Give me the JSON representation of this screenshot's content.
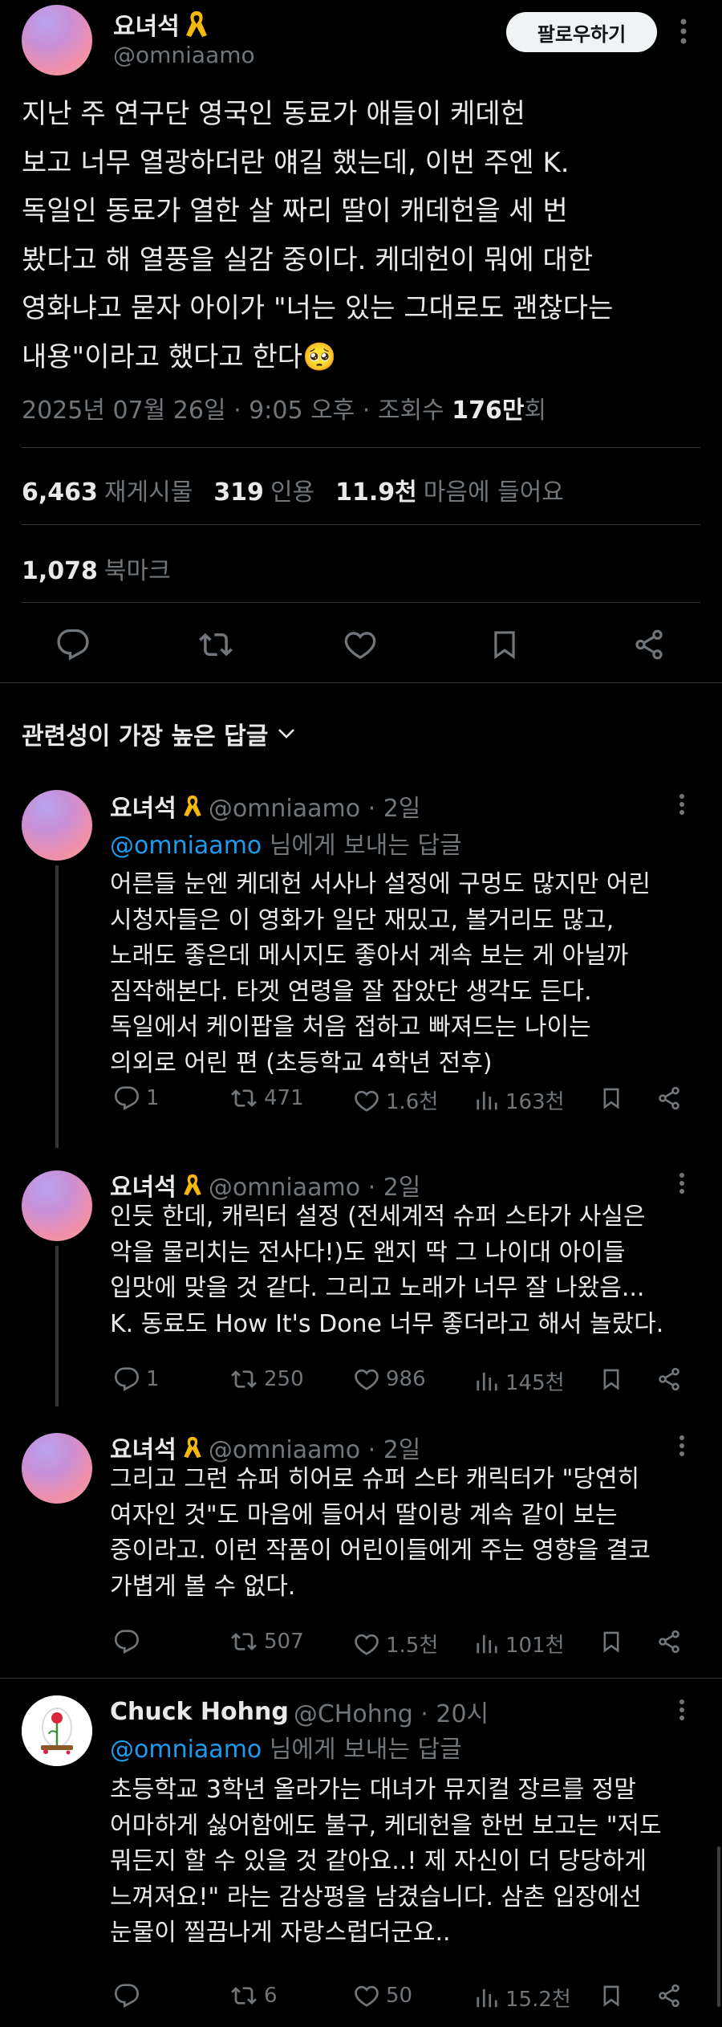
{
  "post": {
    "author_name": "요녀석",
    "author_handle": "@omniaamo",
    "follow_label": "팔로우하기",
    "text_lines": [
      "지난 주 연구단 영국인 동료가 애들이 케데헌",
      "보고 너무 열광하더란 얘길 했는데, 이번 주엔 K.",
      "독일인 동료가 열한 살 짜리 딸이 캐데헌을 세 번",
      "봤다고 해 열풍을 실감 중이다. 케데헌이 뭐에 대한",
      "영화냐고 묻자 아이가 \"너는 있는 그대로도 괜찮다는",
      "내용\"이라고 했다고 한다🥺"
    ],
    "meta_date": "2025년 07월 26일 · 9:05 오후 · 조회수 ",
    "meta_views": "176만",
    "meta_views_suffix": "회",
    "reposts_count": "6,463",
    "reposts_label": "재게시물",
    "quotes_count": "319",
    "quotes_label": "인용",
    "likes_count": "11.9천",
    "likes_label": "마음에 들어요",
    "bookmarks_count": "1,078",
    "bookmarks_label": "북마크"
  },
  "sort_label": "관련성이 가장 높은 답글",
  "replies": [
    {
      "name": "요녀석",
      "handle_time": "@omniaamo · 2일",
      "to_handle": "@omniaamo",
      "to_suffix": " 님에게 보내는 답글",
      "lines": [
        "어른들 눈엔 케데헌 서사나 설정에 구멍도 많지만 어린",
        "시청자들은 이 영화가 일단 재밌고, 볼거리도 많고,",
        "노래도 좋은데 메시지도 좋아서 계속 보는 게 아닐까",
        "짐작해본다. 타겟 연령을 잘 잡았단 생각도 든다.",
        "독일에서 케이팝을 처음 접하고 빠져드는 나이는",
        "의외로 어린 편 (초등학교 4학년 전후)"
      ],
      "replies": "1",
      "reposts": "471",
      "likes": "1.6천",
      "views": "163천"
    },
    {
      "name": "요녀석",
      "handle_time": "@omniaamo · 2일",
      "lines": [
        "인듯 한데, 캐릭터 설정 (전세계적 슈퍼 스타가 사실은",
        "악을 물리치는 전사다!)도 왠지 딱 그 나이대 아이들",
        "입맛에 맞을 것 같다. 그리고 노래가 너무 잘 나왔음...",
        "K. 동료도 How It's Done 너무 좋더라고 해서 놀랐다."
      ],
      "replies": "1",
      "reposts": "250",
      "likes": "986",
      "views": "145천"
    },
    {
      "name": "요녀석",
      "handle_time": "@omniaamo · 2일",
      "lines": [
        "그리고 그런 슈퍼 히어로 슈퍼 스타 캐릭터가 \"당연히",
        "여자인 것\"도 마음에 들어서 딸이랑 계속 같이 보는",
        "중이라고. 이런 작품이 어린이들에게 주는 영향을 결코",
        "가볍게 볼 수 없다."
      ],
      "replies": "",
      "reposts": "507",
      "likes": "1.5천",
      "views": "101천"
    },
    {
      "name": "Chuck Hohng",
      "handle_time": "@CHohng · 20시",
      "to_handle": "@omniaamo",
      "to_suffix": " 님에게 보내는 답글",
      "lines": [
        "초등학교 3학년 올라가는 대녀가 뮤지컬 장르를 정말",
        "어마하게 싫어함에도 불구, 케데헌을 한번 보고는 \"저도",
        "뭐든지 할 수 있을 것 같아요..! 제 자신이 더 당당하게",
        "느껴져요!\" 라는 감상평을 남겼습니다. 삼촌 입장에선",
        "눈물이 찔끔나게 자랑스럽더군요.."
      ],
      "replies": "",
      "reposts": "6",
      "likes": "50",
      "views": "15.2천"
    }
  ]
}
